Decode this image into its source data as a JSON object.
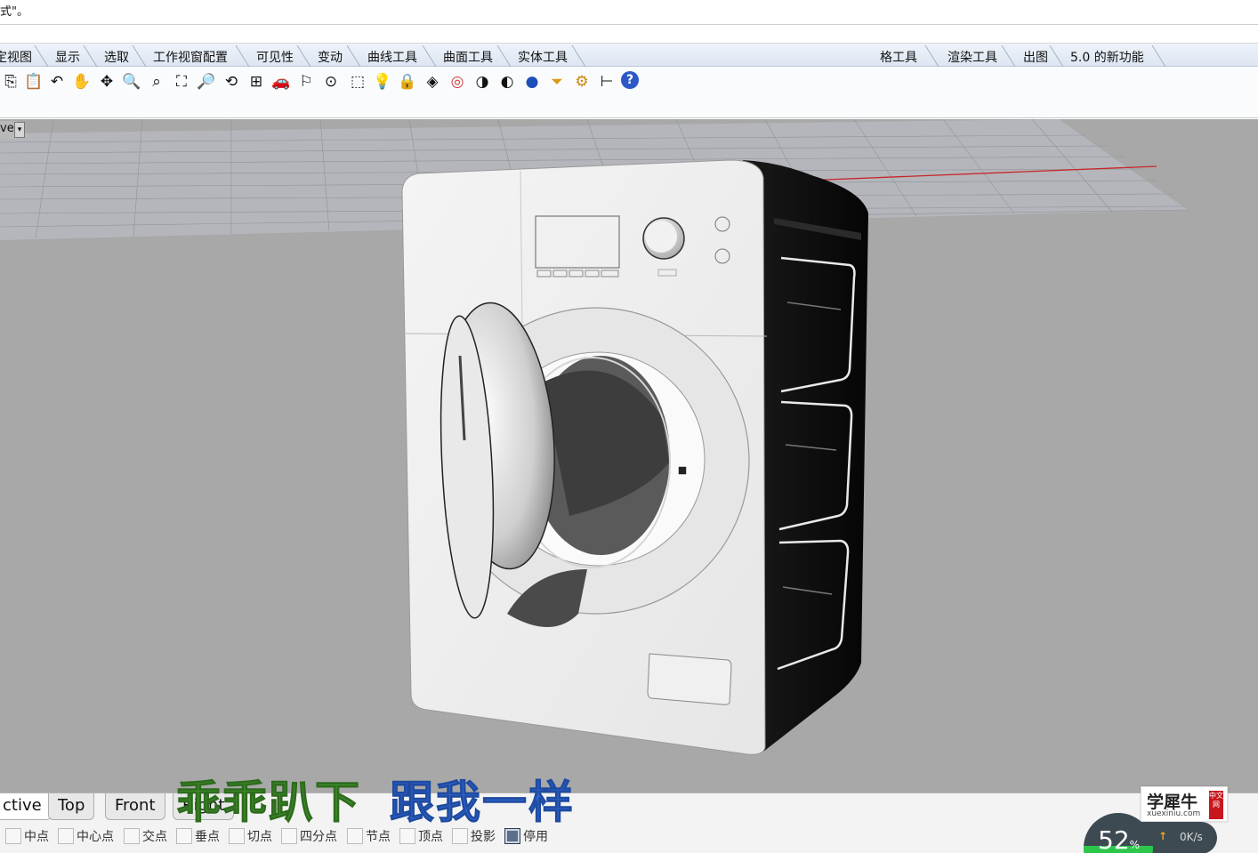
{
  "command": {
    "text": "式\"。"
  },
  "menu_tabs": [
    {
      "label": "定视图"
    },
    {
      "label": "显示"
    },
    {
      "label": "选取"
    },
    {
      "label": "工作视窗配置"
    },
    {
      "label": "可见性"
    },
    {
      "label": "变动"
    },
    {
      "label": "曲线工具"
    },
    {
      "label": "曲面工具"
    },
    {
      "label": "实体工具"
    },
    {
      "label": "格工具"
    },
    {
      "label": "渲染工具"
    },
    {
      "label": "出图"
    },
    {
      "label": "5.0 的新功能"
    }
  ],
  "toolbar_icons": [
    {
      "name": "copy-icon",
      "glyph": "⎘"
    },
    {
      "name": "paste-icon",
      "glyph": "📋"
    },
    {
      "name": "undo-icon",
      "glyph": "↶"
    },
    {
      "name": "pan-hand-icon",
      "glyph": "✋"
    },
    {
      "name": "move-view-icon",
      "glyph": "✥"
    },
    {
      "name": "zoom-icon",
      "glyph": "🔍"
    },
    {
      "name": "zoom-window-icon",
      "glyph": "⌕"
    },
    {
      "name": "zoom-extents-icon",
      "glyph": "⛶"
    },
    {
      "name": "zoom-selected-icon",
      "glyph": "🔎"
    },
    {
      "name": "rotate-view-icon",
      "glyph": "⟲"
    },
    {
      "name": "four-viewports-icon",
      "glyph": "⊞"
    },
    {
      "name": "car-icon",
      "glyph": "🚗"
    },
    {
      "name": "named-view-icon",
      "glyph": "⚐"
    },
    {
      "name": "camera-target-icon",
      "glyph": "⊙"
    },
    {
      "name": "select-points-icon",
      "glyph": "⬚"
    },
    {
      "name": "light-bulb-icon",
      "glyph": "💡"
    },
    {
      "name": "lock-icon",
      "glyph": "🔒"
    },
    {
      "name": "layer-icon",
      "glyph": "◈"
    },
    {
      "name": "color-wheel-icon",
      "glyph": "◎"
    },
    {
      "name": "shaded-sphere-icon",
      "glyph": "◑"
    },
    {
      "name": "rendered-sphere-icon",
      "glyph": "◐"
    },
    {
      "name": "blue-sphere-icon",
      "glyph": "●"
    },
    {
      "name": "filter-icon",
      "glyph": "⏷"
    },
    {
      "name": "settings-gear-icon",
      "glyph": "⚙"
    },
    {
      "name": "dimension-icon",
      "glyph": "⊢"
    },
    {
      "name": "help-icon",
      "glyph": "?"
    }
  ],
  "viewport": {
    "label": "ve"
  },
  "view_tabs": [
    {
      "label": "ctive"
    },
    {
      "label": "Top"
    },
    {
      "label": "Front"
    },
    {
      "label": "Right"
    }
  ],
  "osnaps": [
    {
      "label": "中点",
      "checked": false
    },
    {
      "label": "中心点",
      "checked": false
    },
    {
      "label": "交点",
      "checked": false
    },
    {
      "label": "垂点",
      "checked": false
    },
    {
      "label": "切点",
      "checked": false
    },
    {
      "label": "四分点",
      "checked": false
    },
    {
      "label": "节点",
      "checked": false
    },
    {
      "label": "顶点",
      "checked": false
    },
    {
      "label": "投影",
      "checked": false
    },
    {
      "label": "停用",
      "checked": true
    }
  ],
  "subtitle": {
    "left": "乖乖趴下",
    "right": "跟我一样"
  },
  "watermark": {
    "title": "学犀牛",
    "site": "xuexiniu.com",
    "badge": "中文网"
  },
  "network": {
    "percent": "52",
    "percent_value": 0.52,
    "unit": "%",
    "rate": "0K/s"
  },
  "colors": {
    "accent_green": "#3f8d2a",
    "accent_blue": "#2c63c9",
    "viewport_bg": "#a8a8a8"
  }
}
